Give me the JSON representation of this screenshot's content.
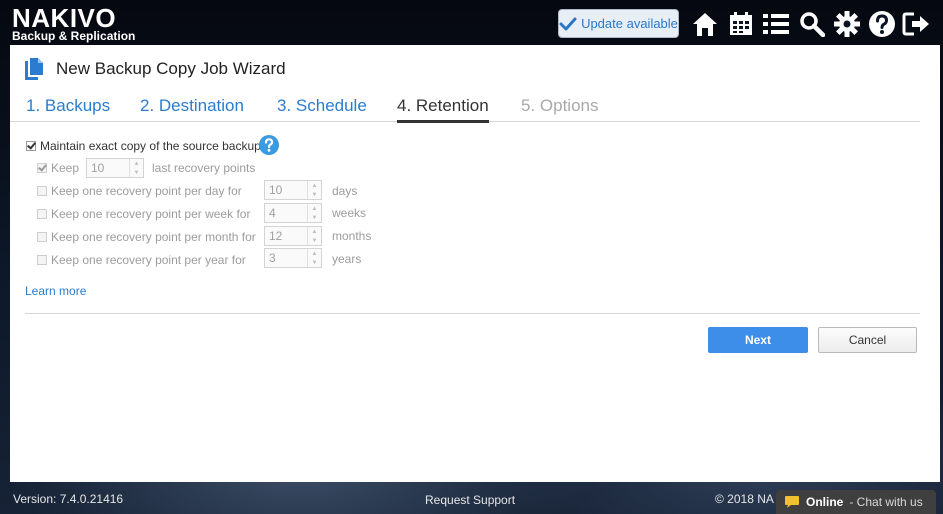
{
  "header": {
    "logo_name": "NAKIVO",
    "logo_sub": "Backup & Replication",
    "update_label": "Update available",
    "nav_icons": [
      "home-icon",
      "calendar-icon",
      "list-icon",
      "search-icon",
      "gear-icon",
      "help-icon",
      "logout-icon"
    ]
  },
  "wizard": {
    "title": "New Backup Copy Job Wizard",
    "tabs": [
      {
        "label": "1. Backups",
        "state": "link"
      },
      {
        "label": "2. Destination",
        "state": "link"
      },
      {
        "label": "3. Schedule",
        "state": "link"
      },
      {
        "label": "4. Retention",
        "state": "active"
      },
      {
        "label": "5. Options",
        "state": "disabled"
      }
    ]
  },
  "retention": {
    "maintain_label": "Maintain exact copy of the source backup",
    "maintain_checked": true,
    "keep_label": "Keep",
    "keep_value": "10",
    "keep_suffix": "last recovery points",
    "per_day_label": "Keep one recovery point per day for",
    "per_day_value": "10",
    "per_day_unit": "days",
    "per_week_label": "Keep one recovery point per week for",
    "per_week_value": "4",
    "per_week_unit": "weeks",
    "per_month_label": "Keep one recovery point per month for",
    "per_month_value": "12",
    "per_month_unit": "months",
    "per_year_label": "Keep one recovery point per year for",
    "per_year_value": "3",
    "per_year_unit": "years",
    "learn_more": "Learn more"
  },
  "actions": {
    "next": "Next",
    "cancel": "Cancel"
  },
  "footer": {
    "version": "Version: 7.4.0.21416",
    "support": "Request Support",
    "copyright": "© 2018 NA",
    "chat_online": "Online",
    "chat_rest": "- Chat with us"
  },
  "colors": {
    "accent": "#2b7ccf",
    "primary_button": "#3d8ee8"
  }
}
